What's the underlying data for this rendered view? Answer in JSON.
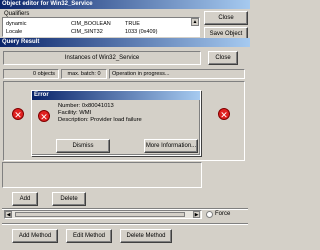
{
  "object_editor": {
    "title": "Object editor for Win32_Service",
    "qualifiers_label": "Qualifiers",
    "qualifier_rows": [
      {
        "name": "dynamic",
        "type": "CIM_BOOLEAN",
        "value": "TRUE"
      },
      {
        "name": "Locale",
        "type": "CIM_SINT32",
        "value": "1033 (0x409)"
      }
    ],
    "close_label": "Close",
    "save_label": "Save Object",
    "add_label": "Add",
    "delete_label": "Delete",
    "force_label": "Force",
    "add_method_label": "Add Method",
    "edit_method_label": "Edit Method",
    "delete_method_label": "Delete Method"
  },
  "query_result": {
    "title": "Query Result",
    "instances_label": "Instances of Win32_Service",
    "close_label": "Close",
    "objects_count": "0 objects",
    "max_batch": "max. batch: 0",
    "status": "Operation in progress..."
  },
  "error_dialog": {
    "title": "Error",
    "number": "Number: 0x80041013",
    "facility": "Facility: WMI",
    "description": "Description: Provider load failure",
    "dismiss_label": "Dismiss",
    "more_info_label": "More Information..."
  },
  "colors": {
    "titlebar_start": "#0a246a",
    "titlebar_end": "#a6caf0",
    "error_icon": "#e02020"
  }
}
